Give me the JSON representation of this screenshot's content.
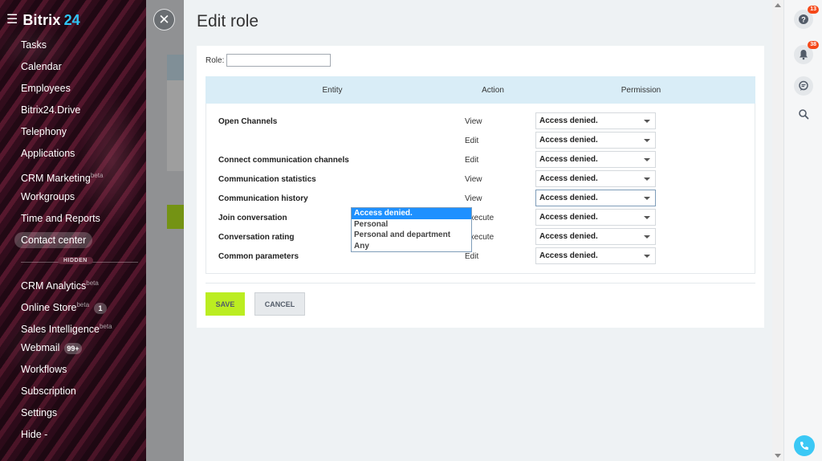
{
  "sidebar": {
    "logo": "Bitrix",
    "logo_suffix": "24",
    "items": [
      {
        "label": "Tasks"
      },
      {
        "label": "Calendar"
      },
      {
        "label": "Employees"
      },
      {
        "label": "Bitrix24.Drive"
      },
      {
        "label": "Telephony"
      },
      {
        "label": "Applications"
      },
      {
        "label": "CRM Marketing",
        "sup": "beta"
      },
      {
        "label": "Workgroups"
      },
      {
        "label": "Time and Reports"
      },
      {
        "label": "Contact center"
      }
    ],
    "hidden_tag": "HIDDEN",
    "hidden_items": [
      {
        "label": "CRM Analytics",
        "sup": "beta"
      },
      {
        "label": "Online Store",
        "sup": "beta",
        "counter": "1"
      },
      {
        "label": "Sales Intelligence",
        "sup": "beta"
      },
      {
        "label": "Webmail",
        "counter": "99+"
      },
      {
        "label": "Workflows"
      },
      {
        "label": "Subscription"
      },
      {
        "label": "Settings"
      },
      {
        "label": "Hide -"
      }
    ]
  },
  "slider": {
    "title": "Edit role",
    "role_label": "Role:",
    "role_value": "",
    "table": {
      "headers": {
        "entity": "Entity",
        "action": "Action",
        "permission": "Permission"
      },
      "rows": [
        {
          "entity": "Open Channels",
          "action": "View",
          "permission": "Access denied."
        },
        {
          "entity": "",
          "action": "Edit",
          "permission": "Access denied."
        },
        {
          "entity": "Connect communication channels",
          "action": "Edit",
          "permission": "Access denied."
        },
        {
          "entity": "Communication statistics",
          "action": "View",
          "permission": "Access denied."
        },
        {
          "entity": "Communication history",
          "action": "View",
          "permission": "Access denied."
        },
        {
          "entity": "Join conversation",
          "action": "Execute",
          "permission": "Access denied."
        },
        {
          "entity": "Conversation rating",
          "action": "Execute",
          "permission": "Access denied."
        },
        {
          "entity": "Common parameters",
          "action": "Edit",
          "permission": "Access denied."
        }
      ]
    },
    "dropdown_options": [
      "Access denied.",
      "Personal",
      "Personal and department",
      "Any"
    ],
    "save_label": "SAVE",
    "cancel_label": "CANCEL"
  },
  "right_panel": {
    "help_badge": "13",
    "notifications_badge": "38"
  },
  "colors": {
    "accent_green": "#bbed21",
    "header_blue": "#d9edf7",
    "dropdown_selected": "#1e90ff",
    "badge_red": "#f54819",
    "call_button": "#3bc8f5"
  }
}
